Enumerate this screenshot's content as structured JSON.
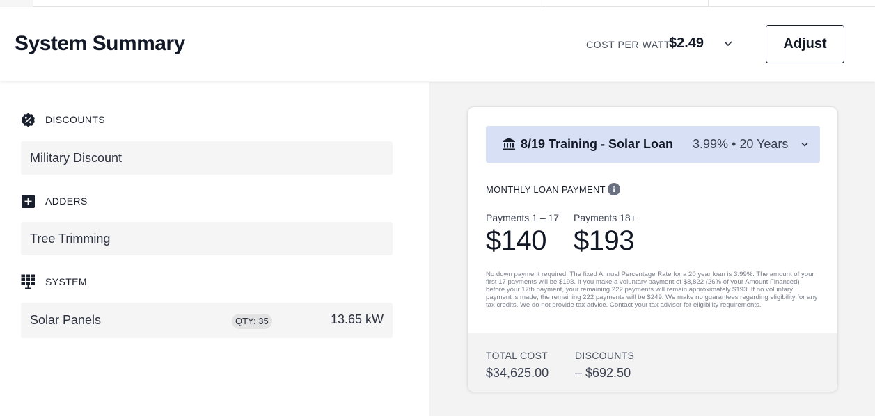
{
  "header": {
    "title": "System Summary",
    "cost_per_watt_label": "COST PER WATT",
    "cost_per_watt_value": "$2.49",
    "adjust_label": "Adjust"
  },
  "sections": {
    "discounts": {
      "label": "DISCOUNTS",
      "icon": "percent-badge-icon",
      "item": "Military Discount"
    },
    "adders": {
      "label": "ADDERS",
      "icon": "plus-square-icon",
      "item": "Tree Trimming"
    },
    "system": {
      "label": "SYSTEM",
      "icon": "solar-panel-icon",
      "item": "Solar Panels",
      "qty": "QTY: 35",
      "size": "13.65 kW"
    }
  },
  "loan": {
    "icon": "bank-icon",
    "name": "8/19 Training - Solar Loan",
    "terms": "3.99% • 20 Years",
    "monthly_label": "MONTHLY LOAN PAYMENT",
    "payments": [
      {
        "label": "Payments 1 – 17",
        "amount": "$140"
      },
      {
        "label": "Payments 18+",
        "amount": "$193"
      }
    ],
    "disclaimer": "No down payment required. The fixed Annual Percentage Rate for a 20 year loan is 3.99%. The amount of your first 17 payments will be $193. If you make a voluntary payment of $8,822 (26% of your Amount Financed) before your 17th payment, your remaining 222 payments will remain approximately $193. If no voluntary payment is made, the remaining 222 payments will be $249. We make no guarantees regarding eligibility for any tax credits. We do not provide tax advice. Contact your tax advisor for eligibility requirements.",
    "total_cost_label": "TOTAL COST",
    "total_cost_value": "$34,625.00",
    "discounts_label": "DISCOUNTS",
    "discounts_value": "– $692.50"
  },
  "colors": {
    "loan_bar": "#d8e0f5",
    "right_panel_bg": "#f3f3f3",
    "text_dark": "#121826"
  }
}
